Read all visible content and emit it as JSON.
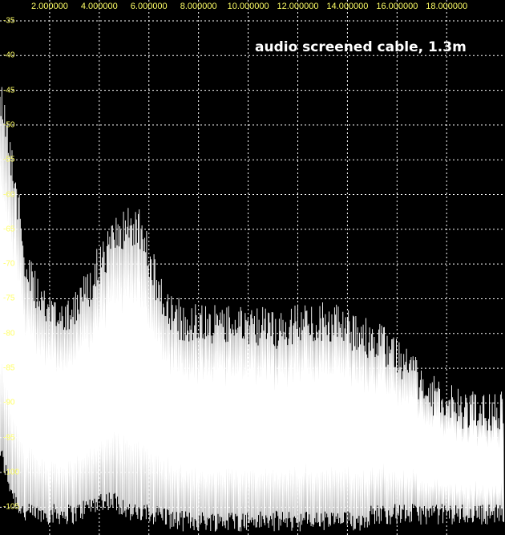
{
  "chart_data": {
    "type": "line",
    "title": "audio screened cable, 1.3m",
    "xlabel": "",
    "ylabel": "",
    "x_ticks": [
      "2.000000",
      "4.000000",
      "6.000000",
      "8.000000",
      "10.000000",
      "12.000000",
      "14.000000",
      "16.000000",
      "18.000000"
    ],
    "x_tick_values": [
      2,
      4,
      6,
      8,
      10,
      12,
      14,
      16,
      18
    ],
    "y_ticks": [
      "-35",
      "-40",
      "-45",
      "-50",
      "-55",
      "-60",
      "-65",
      "-70",
      "-75",
      "-80",
      "-85",
      "-90",
      "-95",
      "-100",
      "-105"
    ],
    "y_tick_values": [
      -35,
      -40,
      -45,
      -50,
      -55,
      -60,
      -65,
      -70,
      -75,
      -80,
      -85,
      -90,
      -95,
      -100,
      -105
    ],
    "xlim": [
      0,
      20.35
    ],
    "ylim": [
      -109,
      -32
    ],
    "grid": true,
    "colors": {
      "background": "#000000",
      "trace": "#ffffff",
      "grid": "#ffffff",
      "ticks": "#ffff66"
    },
    "series": [
      {
        "values_x": [
          0.0,
          0.3,
          0.6,
          1.0,
          1.5,
          2.0,
          2.5,
          3.0,
          3.5,
          4.0,
          4.5,
          5.0,
          5.3,
          5.6,
          6.0,
          6.5,
          7.0,
          7.5,
          8.0,
          8.5,
          9.0,
          9.5,
          10.0,
          10.5,
          11.0,
          11.5,
          12.0,
          12.5,
          13.0,
          13.5,
          14.0,
          14.5,
          15.0,
          15.5,
          16.0,
          16.5,
          17.0,
          17.5,
          18.0,
          18.5,
          19.0,
          19.5,
          20.0,
          20.3
        ],
        "envelope_db": [
          -42,
          -48,
          -55,
          -66,
          -72,
          -74,
          -74,
          -73,
          -71,
          -67,
          -64,
          -62,
          -61.5,
          -62,
          -66,
          -72,
          -74,
          -76,
          -75,
          -76,
          -75.5,
          -76,
          -76.5,
          -76,
          -76.5,
          -76,
          -75.5,
          -75.5,
          -75.5,
          -75.5,
          -76,
          -78,
          -77.5,
          -79,
          -80,
          -82,
          -84,
          -86,
          -87,
          -88,
          -88,
          -88,
          -88,
          -88
        ],
        "floor_db": [
          -97,
          -101,
          -104,
          -106,
          -106,
          -106,
          -106,
          -106,
          -105,
          -104,
          -104,
          -105,
          -106,
          -106,
          -106,
          -106,
          -107,
          -107,
          -107,
          -107,
          -107,
          -107,
          -107,
          -107,
          -107,
          -107,
          -107,
          -107,
          -107,
          -107,
          -107,
          -107,
          -106,
          -106,
          -106,
          -106,
          -106,
          -106,
          -106,
          -106,
          -106,
          -106,
          -106,
          -106
        ]
      }
    ]
  }
}
